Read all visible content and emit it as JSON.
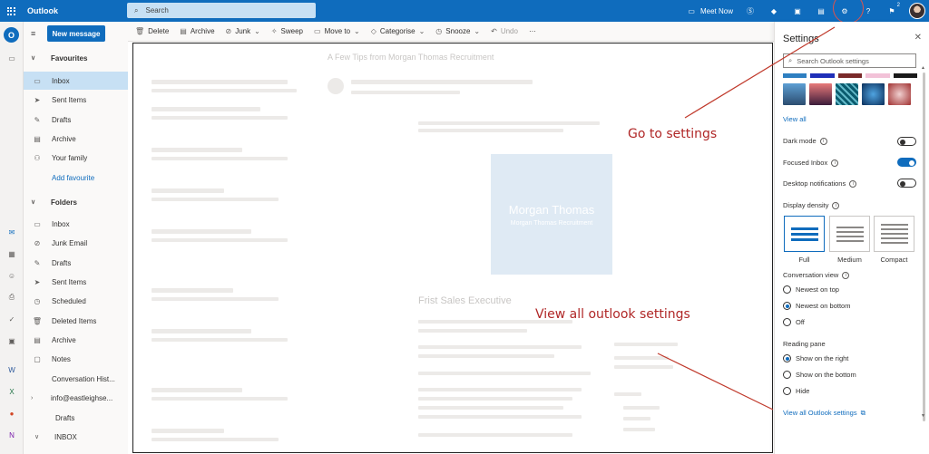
{
  "topbar": {
    "app_title": "Outlook",
    "search_placeholder": "Search",
    "meet_now": "Meet Now",
    "notification_count": "2"
  },
  "folders": {
    "new_message": "New message",
    "favourites_header": "Favourites",
    "favourites": [
      "Inbox",
      "Sent Items",
      "Drafts",
      "Archive",
      "Your family"
    ],
    "add_favourite": "Add favourite",
    "folders_header": "Folders",
    "folder_items": [
      "Inbox",
      "Junk Email",
      "Drafts",
      "Sent Items",
      "Scheduled",
      "Deleted Items",
      "Archive",
      "Notes",
      "Conversation Hist...",
      "info@eastleighse...",
      "Drafts",
      "INBOX"
    ]
  },
  "command_bar": {
    "delete": "Delete",
    "archive": "Archive",
    "junk": "Junk",
    "sweep": "Sweep",
    "move_to": "Move to",
    "categorise": "Categorise",
    "snooze": "Snooze",
    "undo": "Undo"
  },
  "content": {
    "subject_ghost": "A Few Tips from Morgan Thomas Recruitment",
    "logo_name": "Morgan Thomas",
    "logo_tag": "Morgan Thomas Recruitment",
    "heading_ghost": "Frist Sales Executive"
  },
  "settings": {
    "title": "Settings",
    "search_placeholder": "Search Outlook settings",
    "view_all_themes": "View all",
    "dark_mode": "Dark mode",
    "focused_inbox": "Focused Inbox",
    "desktop_notifications": "Desktop notifications",
    "display_density": "Display density",
    "density_full": "Full",
    "density_medium": "Medium",
    "density_compact": "Compact",
    "conversation_view": "Conversation view",
    "conv_newest_top": "Newest on top",
    "conv_newest_bottom": "Newest on bottom",
    "conv_off": "Off",
    "reading_pane": "Reading pane",
    "rp_right": "Show on the right",
    "rp_bottom": "Show on the bottom",
    "rp_hide": "Hide",
    "view_all_settings": "View all Outlook settings",
    "toggles": {
      "dark_mode": false,
      "focused_inbox": true,
      "desktop_notifications": false
    },
    "selected_density": "Full",
    "selected_conversation": "Newest on bottom",
    "selected_reading_pane": "Show on the right"
  },
  "annotations": {
    "go_to_settings": "Go to settings",
    "view_all_outlook_settings": "View all outlook settings"
  },
  "colors": {
    "brand": "#0f6cbd",
    "annotation": "#b02727"
  }
}
